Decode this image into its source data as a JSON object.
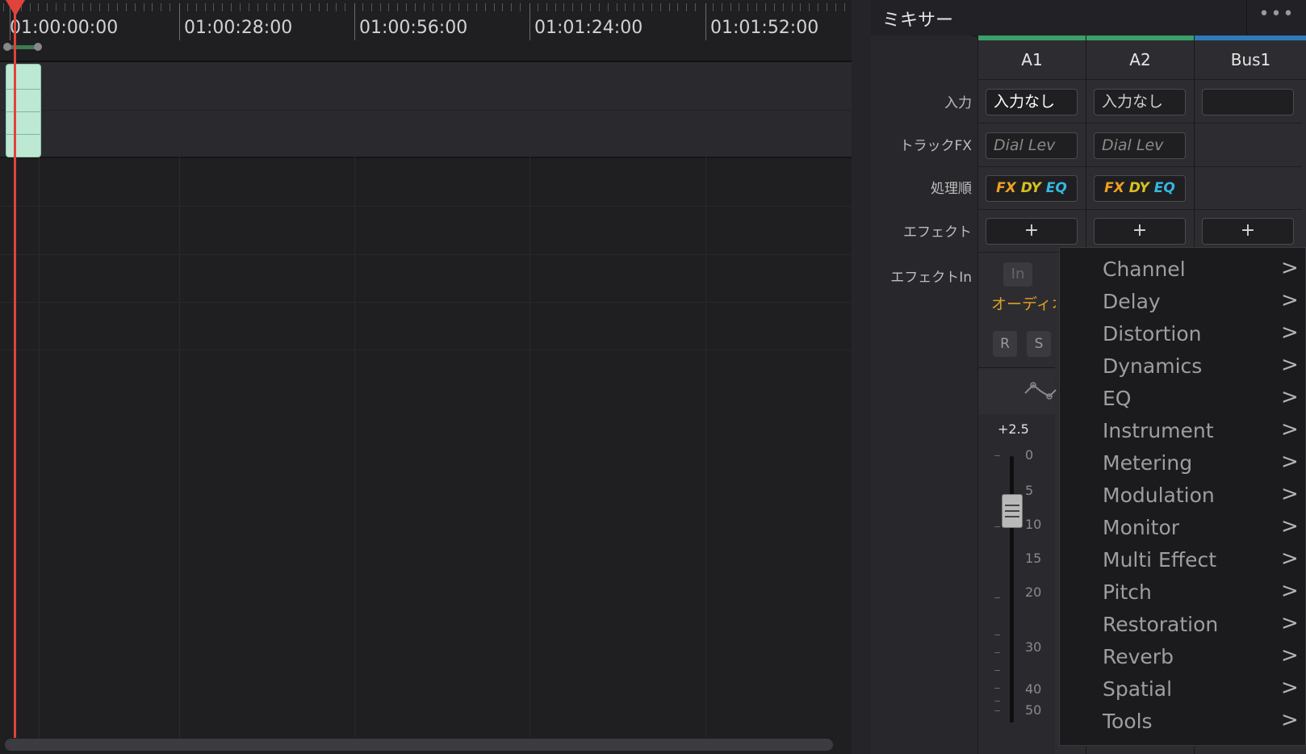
{
  "timeline": {
    "timecodes": [
      "01:00:00:00",
      "01:00:28:00",
      "01:00:56:00",
      "01:01:24:00",
      "01:01:52:00"
    ]
  },
  "mixer": {
    "title": "ミキサー",
    "more": "•••",
    "row_labels": {
      "input": "入力",
      "track_fx": "トラックFX",
      "order": "処理順",
      "effects": "エフェクト",
      "effects_in": "エフェクトIn"
    },
    "colors": {
      "a1": "#3aa06a",
      "a2": "#3aa06a",
      "bus1": "#2f7ab8",
      "accent_fx": "#f0a020",
      "accent_dy": "#d8c020",
      "accent_eq": "#35b8e0"
    },
    "strips": [
      {
        "name": "A1",
        "input": "入力なし",
        "track_fx": "Dial Lev",
        "add": "+"
      },
      {
        "name": "A2",
        "input": "入力なし",
        "track_fx": "Dial Lev",
        "add": "+"
      },
      {
        "name": "Bus1",
        "input": "",
        "add": "+"
      }
    ],
    "order_tags": {
      "fx": "FX",
      "dy": "DY",
      "eq": "EQ"
    },
    "in_button": "In",
    "audio_label": "オーディオ",
    "r_button": "R",
    "s_button": "S",
    "fader_value": "+2.5",
    "fader_scale": [
      "0",
      "5",
      "10",
      "15",
      "20",
      "30",
      "40",
      "50"
    ]
  },
  "menu": {
    "items": [
      {
        "label": "Channel",
        "arrow": ">"
      },
      {
        "label": "Delay",
        "arrow": ">"
      },
      {
        "label": "Distortion",
        "arrow": ">"
      },
      {
        "label": "Dynamics",
        "arrow": ">"
      },
      {
        "label": "EQ",
        "arrow": ">"
      },
      {
        "label": "Instrument",
        "arrow": ">"
      },
      {
        "label": "Metering",
        "arrow": ">"
      },
      {
        "label": "Modulation",
        "arrow": ">"
      },
      {
        "label": "Monitor",
        "arrow": ">"
      },
      {
        "label": "Multi Effect",
        "arrow": ">"
      },
      {
        "label": "Pitch",
        "arrow": ">"
      },
      {
        "label": "Restoration",
        "arrow": ">"
      },
      {
        "label": "Reverb",
        "arrow": ">"
      },
      {
        "label": "Spatial",
        "arrow": ">"
      },
      {
        "label": "Tools",
        "arrow": ">"
      }
    ]
  }
}
